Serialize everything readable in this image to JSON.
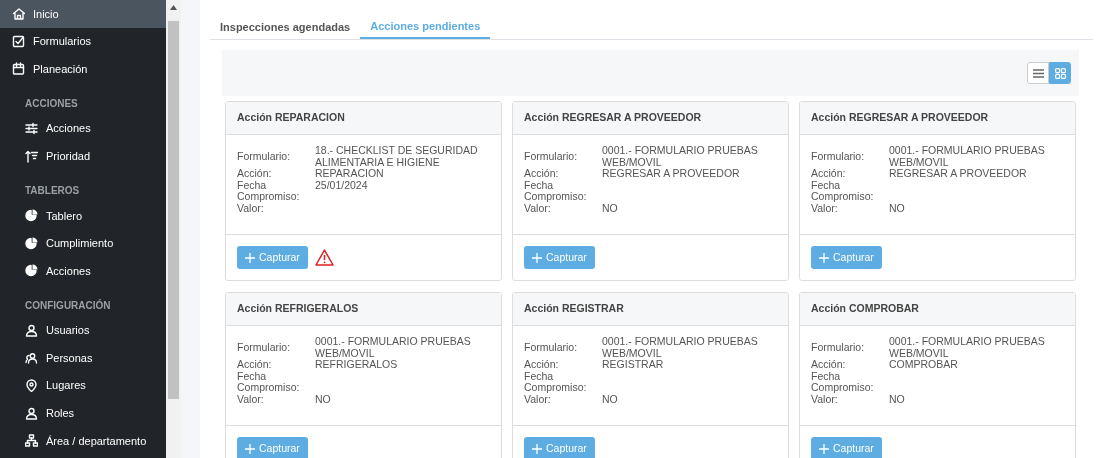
{
  "sidebar": {
    "items": [
      {
        "kind": "item",
        "label": "Inicio",
        "selected": true
      },
      {
        "kind": "item",
        "label": "Formularios",
        "selected": false
      },
      {
        "kind": "item",
        "label": "Planeación",
        "selected": false
      },
      {
        "kind": "header",
        "label": "ACCIONES"
      },
      {
        "kind": "sub",
        "label": "Acciones",
        "selected": false
      },
      {
        "kind": "sub",
        "label": "Prioridad",
        "selected": false
      },
      {
        "kind": "header",
        "label": "TABLEROS"
      },
      {
        "kind": "sub",
        "label": "Tablero",
        "selected": false
      },
      {
        "kind": "sub",
        "label": "Cumplimiento",
        "selected": false
      },
      {
        "kind": "sub",
        "label": "Acciones",
        "selected": false
      },
      {
        "kind": "header",
        "label": "CONFIGURACIÓN"
      },
      {
        "kind": "sub",
        "label": "Usuarios",
        "selected": false
      },
      {
        "kind": "sub",
        "label": "Personas",
        "selected": false
      },
      {
        "kind": "sub",
        "label": "Lugares",
        "selected": false
      },
      {
        "kind": "sub",
        "label": "Roles",
        "selected": false
      },
      {
        "kind": "sub",
        "label": "Área / departamento",
        "selected": false
      }
    ]
  },
  "tabs": [
    {
      "label": "Inspecciones agendadas",
      "selected": false
    },
    {
      "label": "Acciones pendientes",
      "selected": true
    }
  ],
  "view_toggle": [
    {
      "kind": "list",
      "selected": false
    },
    {
      "kind": "grid",
      "selected": true
    }
  ],
  "cards": [
    {
      "title": "Acción REPARACION",
      "warning": true,
      "button": "Capturar",
      "fields": [
        {
          "label": "Formulario:",
          "value": "18.- CHECKLIST DE SEGURIDAD ALIMENTARIA E HIGIENE"
        },
        {
          "label": "Acción:",
          "value": "REPARACION"
        },
        {
          "label": "Fecha Compromiso:",
          "value": "25/01/2024"
        },
        {
          "label": "Valor:"
        }
      ]
    },
    {
      "title": "Acción REGRESAR A PROVEEDOR",
      "warning": false,
      "button": "Capturar",
      "fields": [
        {
          "label": "Formulario:",
          "value": "0001.- FORMULARIO PRUEBAS WEB/MOVIL"
        },
        {
          "label": "Acción:",
          "value": "REGRESAR A PROVEEDOR"
        },
        {
          "label": "Fecha Compromiso:"
        },
        {
          "label": "Valor:",
          "value": "NO"
        }
      ]
    },
    {
      "title": "Acción REGRESAR A PROVEEDOR",
      "warning": false,
      "button": "Capturar",
      "fields": [
        {
          "label": "Formulario:",
          "value": "0001.- FORMULARIO PRUEBAS WEB/MOVIL"
        },
        {
          "label": "Acción:",
          "value": "REGRESAR A PROVEEDOR"
        },
        {
          "label": "Fecha Compromiso:"
        },
        {
          "label": "Valor:",
          "value": "NO"
        }
      ]
    },
    {
      "title": "Acción REFRIGERALOS",
      "warning": false,
      "button": "Capturar",
      "fields": [
        {
          "label": "Formulario:",
          "value": "0001.- FORMULARIO PRUEBAS WEB/MOVIL"
        },
        {
          "label": "Acción:",
          "value": "REFRIGERALOS"
        },
        {
          "label": "Fecha Compromiso:"
        },
        {
          "label": "Valor:",
          "value": "NO"
        }
      ]
    },
    {
      "title": "Acción REGISTRAR",
      "warning": false,
      "button": "Capturar",
      "fields": [
        {
          "label": "Formulario:",
          "value": "0001.- FORMULARIO PRUEBAS WEB/MOVIL"
        },
        {
          "label": "Acción:",
          "value": "REGISTRAR"
        },
        {
          "label": "Fecha Compromiso:"
        },
        {
          "label": "Valor:",
          "value": "NO"
        }
      ]
    },
    {
      "title": "Acción COMPROBAR",
      "warning": false,
      "button": "Capturar",
      "fields": [
        {
          "label": "Formulario:",
          "value": "0001.- FORMULARIO PRUEBAS WEB/MOVIL"
        },
        {
          "label": "Acción:",
          "value": "COMPROBAR"
        },
        {
          "label": "Fecha Compromiso:"
        },
        {
          "label": "Valor:",
          "value": "NO"
        }
      ]
    }
  ]
}
